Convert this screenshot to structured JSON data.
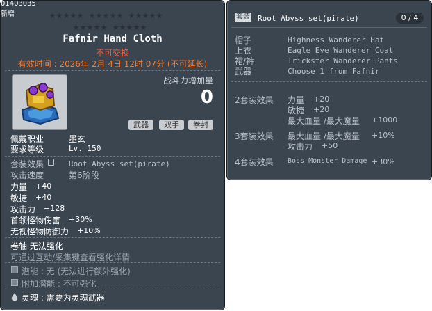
{
  "corner": {
    "id": "01403035",
    "new_label": "新增"
  },
  "item": {
    "name": "Fafnir Hand Cloth",
    "untradeable": "不可交换",
    "expiry": "有效时间 : 2026年 2月 4日 12时 07分 (不可延长)",
    "power_label": "战斗力增加量",
    "power_value": "0",
    "chips": [
      "武器",
      "双手",
      "拳封"
    ],
    "job_label": "佩戴职业",
    "job_value": "墨玄",
    "level_label": "要求等级",
    "level_value": "Lv. 150",
    "set_label": "套装效果",
    "set_value": "Root Abyss set(pirate)",
    "speed_label": "攻击速度",
    "speed_value": "第6阶段",
    "stats": [
      {
        "label": "力量",
        "value": "+40"
      },
      {
        "label": "敏捷",
        "value": "+40"
      },
      {
        "label": "攻击力",
        "value": "+128"
      },
      {
        "label": "首领怪物伤害",
        "value": "+30%"
      },
      {
        "label": "无视怪物防御力",
        "value": "+10%"
      }
    ],
    "scroll": "卷轴 无法强化",
    "scroll_hint": "可通过互动/采集键查看强化详情",
    "potential": "潜能 : 无 (无法进行额外强化)",
    "bonus_potential": "附加潜能 : 不可强化",
    "soul": "灵魂 : 需要为灵魂武器"
  },
  "set_panel": {
    "badge": "套装",
    "title": "Root Abyss set(pirate)",
    "count": "0 / 4",
    "pieces": [
      {
        "slot": "帽子",
        "name": "Highness Wanderer Hat"
      },
      {
        "slot": "上衣",
        "name": "Eagle Eye Wanderer Coat"
      },
      {
        "slot": "裙/裤",
        "name": "Trickster Wanderer Pants"
      },
      {
        "slot": "武器",
        "name": "Choose 1 from Fafnir"
      }
    ],
    "effects": [
      {
        "tier": "2套装效果",
        "lines": [
          {
            "label": "力量",
            "value": "+20"
          },
          {
            "label": "敏捷",
            "value": "+20"
          },
          {
            "label": "最大血量 /最大魔量",
            "value": "+1000"
          }
        ]
      },
      {
        "tier": "3套装效果",
        "lines": [
          {
            "label": "最大血量 /最大魔量",
            "value": "+10%"
          },
          {
            "label": "攻击力",
            "value": "+50"
          }
        ]
      },
      {
        "tier": "4套装效果",
        "lines": [
          {
            "label": "Boss Monster Damage",
            "value": "+30%"
          }
        ]
      }
    ]
  },
  "colors": {
    "panel": "#3a4550",
    "accent_red": "#ff5a3c",
    "expiry": "#ff7a2a"
  }
}
